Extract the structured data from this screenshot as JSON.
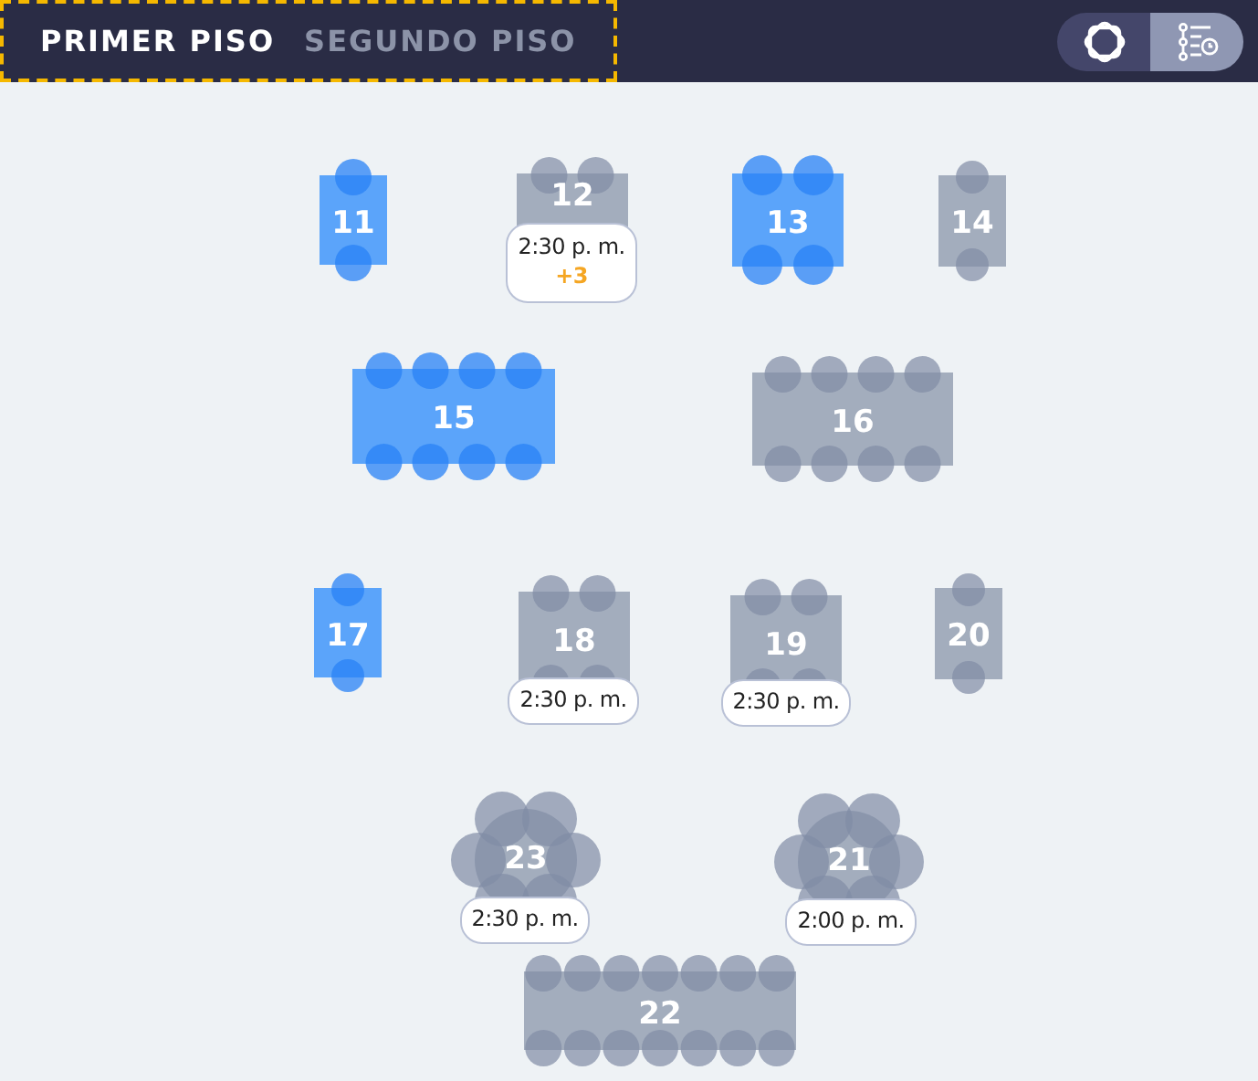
{
  "floors": [
    {
      "label": "PRIMER PISO",
      "selected": true
    },
    {
      "label": "SEGUNDO PISO",
      "selected": false
    }
  ],
  "view_toggle": [
    {
      "selected": false
    },
    {
      "selected": true
    }
  ],
  "tables": [
    {
      "number": "11",
      "kind": "rect",
      "color": "#5ba4fa"
    },
    {
      "number": "12",
      "kind": "rect",
      "color": "#a3adbd",
      "reservation": {
        "time": "2:30 p. m.",
        "extra": "+3"
      }
    },
    {
      "number": "13",
      "kind": "rect",
      "color": "#5ba4fa"
    },
    {
      "number": "14",
      "kind": "rect",
      "color": "#a3adbd"
    },
    {
      "number": "15",
      "kind": "rect",
      "color": "#5ba4fa"
    },
    {
      "number": "16",
      "kind": "rect",
      "color": "#a3adbd"
    },
    {
      "number": "17",
      "kind": "rect",
      "color": "#5ba4fa"
    },
    {
      "number": "18",
      "kind": "rect",
      "color": "#a3adbd",
      "reservation": {
        "time": "2:30 p. m."
      }
    },
    {
      "number": "19",
      "kind": "rect",
      "color": "#a3adbd",
      "reservation": {
        "time": "2:30 p. m."
      }
    },
    {
      "number": "20",
      "kind": "rect",
      "color": "#a3adbd"
    },
    {
      "number": "23",
      "kind": "round",
      "color": "#a3adbd",
      "reservation": {
        "time": "2:30 p. m."
      }
    },
    {
      "number": "21",
      "kind": "round",
      "color": "#a3adbd",
      "reservation": {
        "time": "2:00 p. m."
      }
    },
    {
      "number": "22",
      "kind": "rect",
      "color": "#a3adbd"
    }
  ]
}
